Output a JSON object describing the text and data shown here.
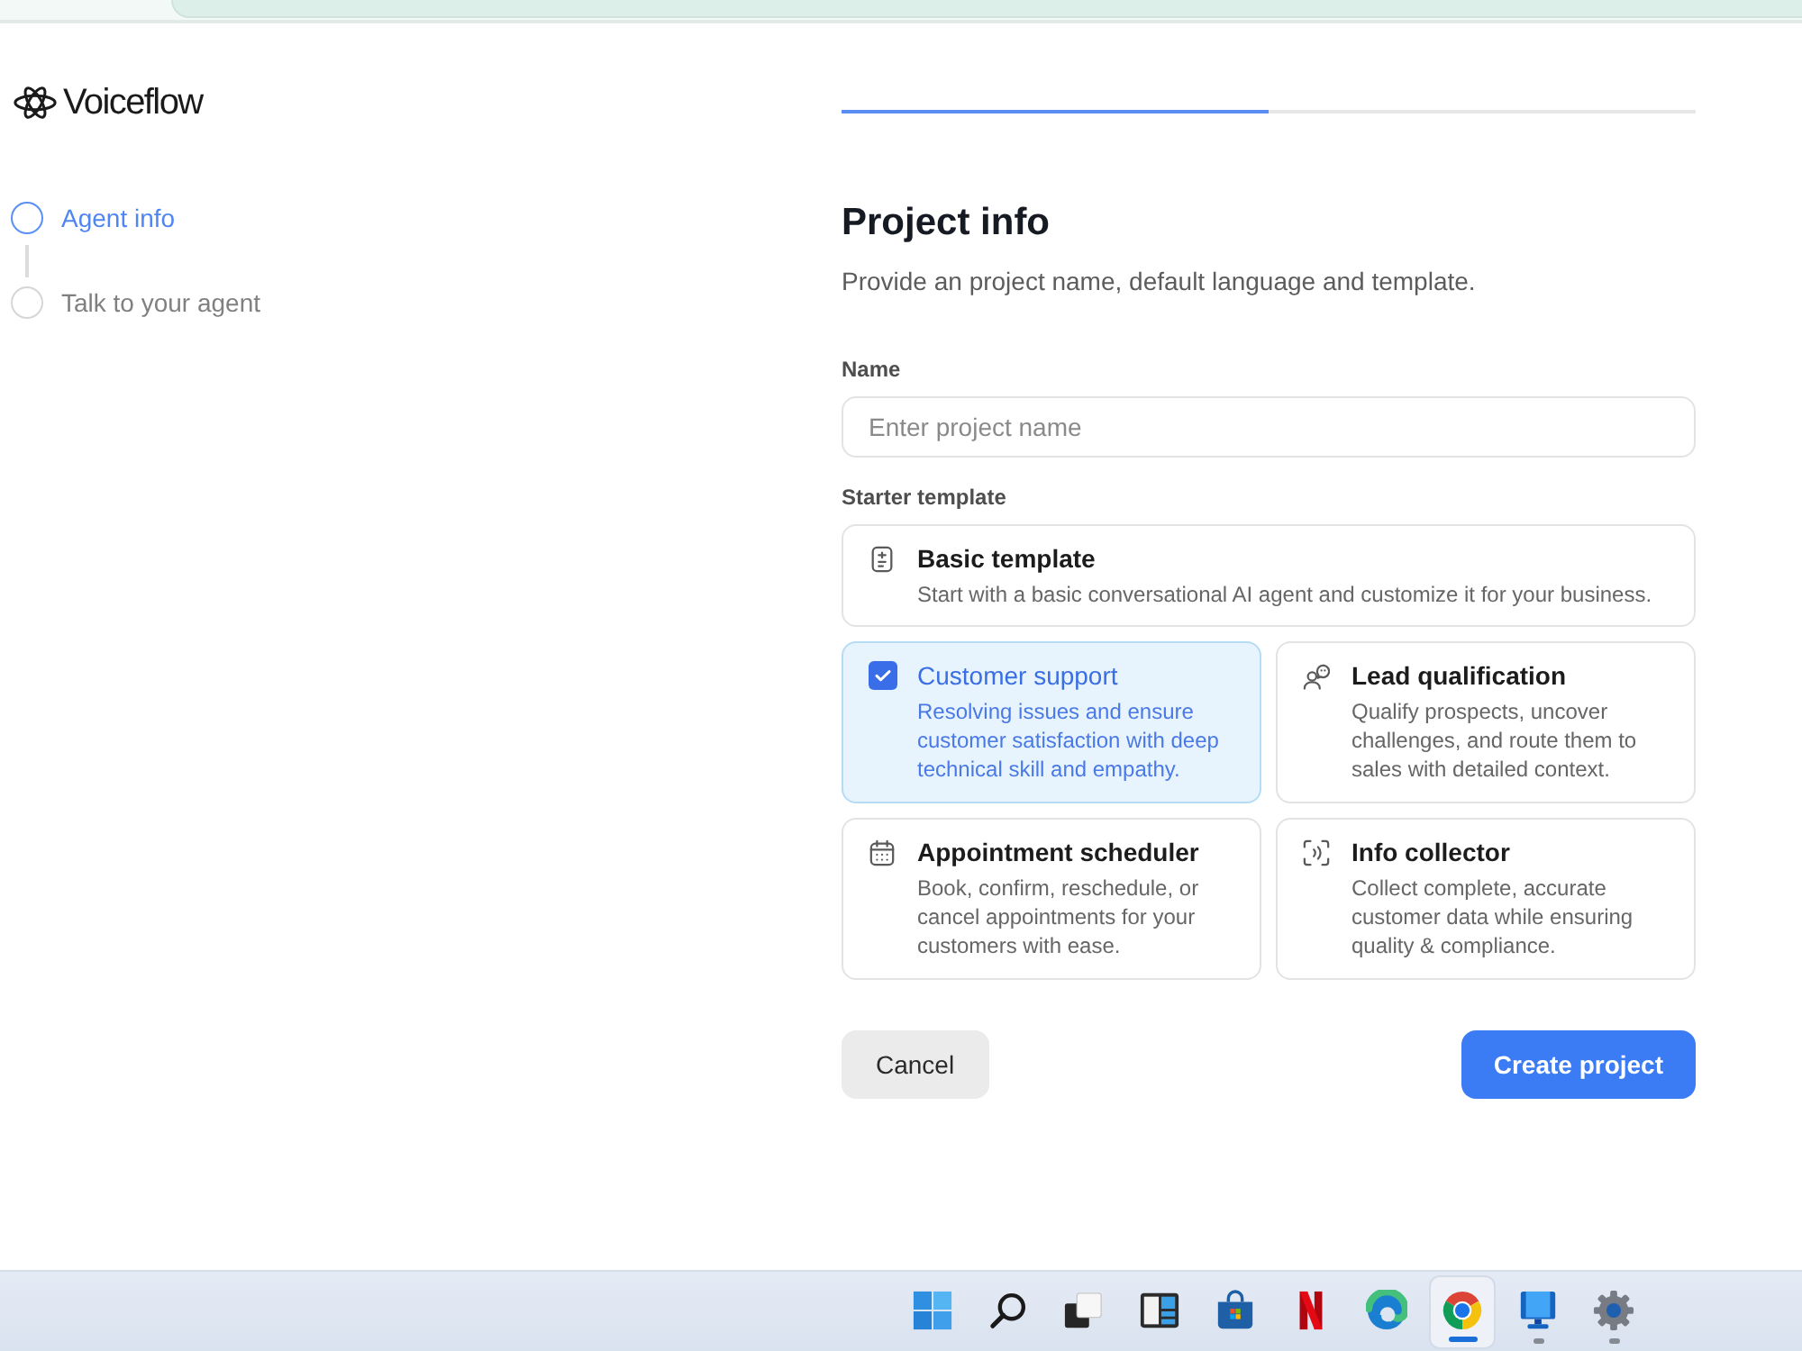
{
  "brand": {
    "name": "Voiceflow"
  },
  "steps": [
    {
      "label": "Agent info",
      "selected": true
    },
    {
      "label": "Talk to your agent",
      "selected": false
    }
  ],
  "progress": {
    "level": 0.5
  },
  "form": {
    "title": "Project info",
    "subtitle": "Provide an project name, default language and template.",
    "name_field": {
      "label": "Name",
      "placeholder": "Enter project name"
    },
    "template_label": "Starter template",
    "templates": [
      {
        "kind": "wide",
        "title": "Basic template",
        "description": "Start with a basic conversational AI agent and customize it for your business.",
        "selected": false
      },
      {
        "kind": "tile",
        "title": "Customer support",
        "description": "Resolving issues and ensure customer satisfaction with deep technical skill and empathy.",
        "selected": true
      },
      {
        "kind": "tile",
        "title": "Lead qualification",
        "description": "Qualify prospects, uncover challenges, and route them to sales with detailed context.",
        "selected": false
      },
      {
        "kind": "tile",
        "title": "Appointment scheduler",
        "description": "Book, confirm, reschedule, or cancel appointments for your customers with ease.",
        "selected": false
      },
      {
        "kind": "tile",
        "title": "Info collector",
        "description": "Collect complete, accurate customer data while ensuring quality & compliance.",
        "selected": false
      }
    ]
  },
  "buttons": [
    {
      "kind": "secondary",
      "label": "Cancel"
    },
    {
      "kind": "primary",
      "label": "Create project"
    }
  ],
  "taskbar": {
    "items": [
      {
        "running": false,
        "selected": false
      },
      {
        "running": false,
        "selected": false
      },
      {
        "running": false,
        "selected": false
      },
      {
        "running": false,
        "selected": false
      },
      {
        "running": false,
        "selected": false
      },
      {
        "running": false,
        "selected": false
      },
      {
        "running": false,
        "selected": false
      },
      {
        "running": true,
        "selected": true
      },
      {
        "running": true,
        "selected": false
      },
      {
        "running": true,
        "selected": false
      }
    ]
  }
}
